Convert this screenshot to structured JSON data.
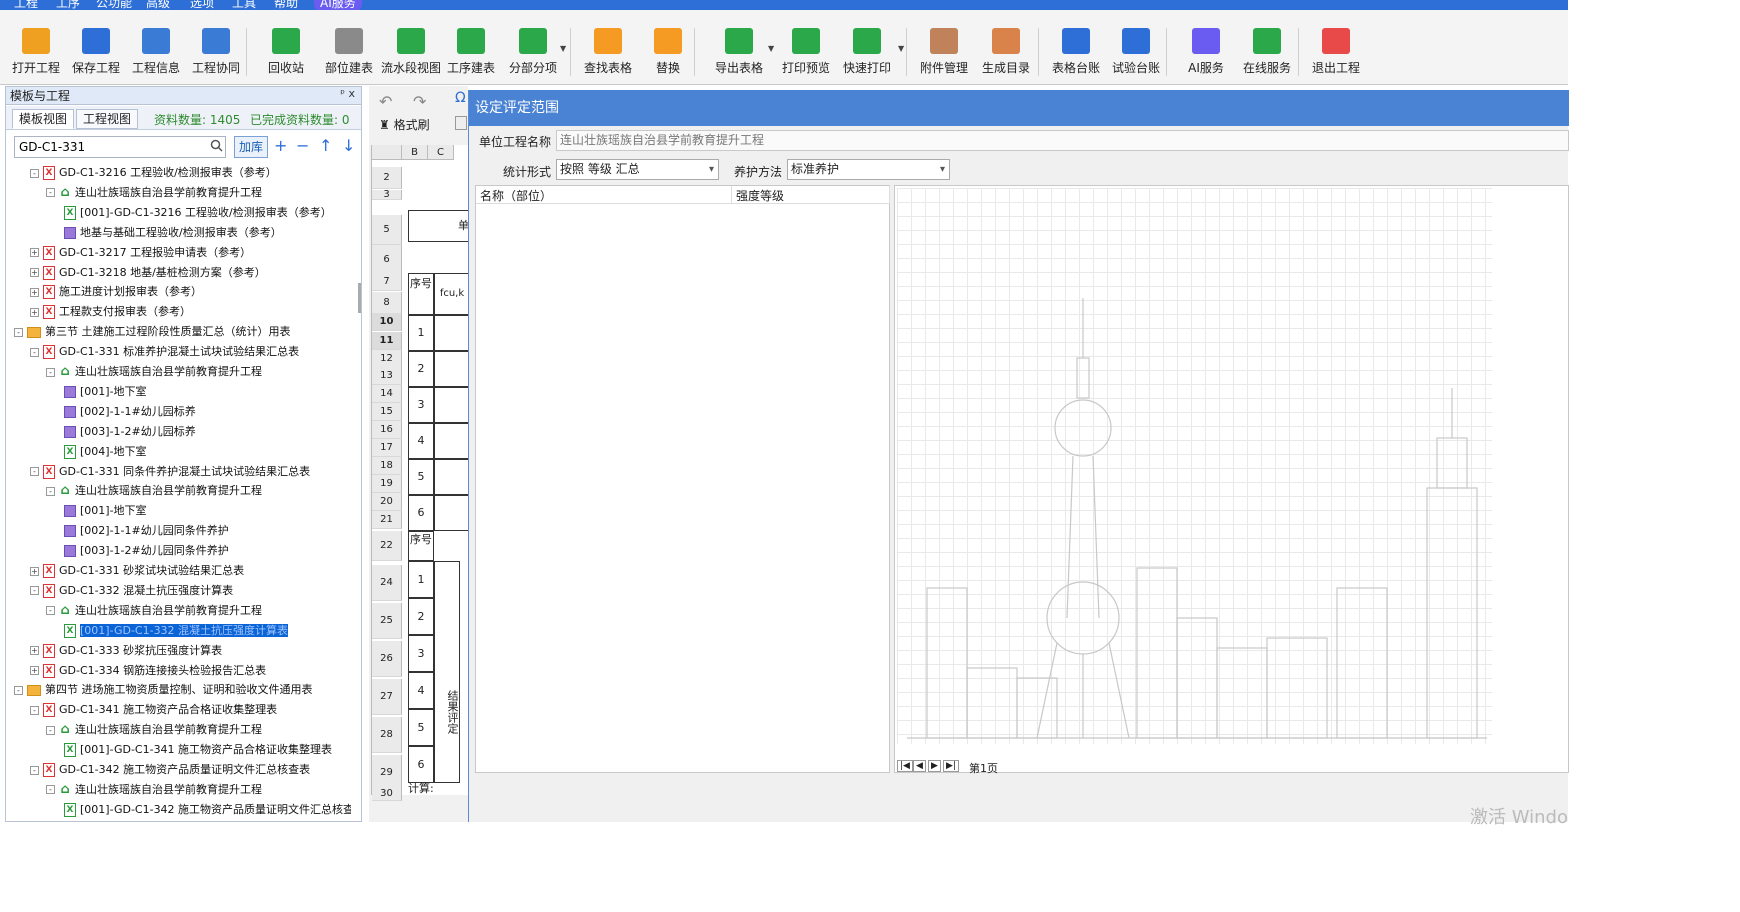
{
  "menu": [
    "工程",
    "工序",
    "公功能",
    "高级",
    "选项",
    "工具",
    "帮助",
    "AI服务"
  ],
  "toolbar": [
    {
      "label": "打开工程",
      "icon": "open-folder-icon",
      "color": "#f0a020"
    },
    {
      "label": "保存工程",
      "icon": "save-icon",
      "color": "#2d6fd6"
    },
    {
      "label": "工程信息",
      "icon": "building-icon",
      "color": "#3a7bd5"
    },
    {
      "label": "工程协同",
      "icon": "handshake-icon",
      "color": "#3a7bd5"
    },
    {
      "label": "回收站",
      "icon": "trash-icon",
      "color": "#2aa84a"
    },
    {
      "label": "部位建表",
      "icon": "part-table-icon",
      "color": "#8a8a8a"
    },
    {
      "label": "流水段视图",
      "icon": "flow-view-icon",
      "color": "#2aa84a"
    },
    {
      "label": "工序建表",
      "icon": "process-table-icon",
      "color": "#2aa84a"
    },
    {
      "label": "分部分项",
      "icon": "chart-icon",
      "color": "#2aa84a"
    },
    {
      "label": "查找表格",
      "icon": "search-icon",
      "color": "#f59a23"
    },
    {
      "label": "替换",
      "icon": "replace-icon",
      "color": "#f59a23"
    },
    {
      "label": "导出表格",
      "icon": "export-icon",
      "color": "#2aa84a"
    },
    {
      "label": "打印预览",
      "icon": "eye-icon",
      "color": "#2aa84a"
    },
    {
      "label": "快速打印",
      "icon": "printer-icon",
      "color": "#2aa84a"
    },
    {
      "label": "附件管理",
      "icon": "attachment-icon",
      "color": "#c0825a"
    },
    {
      "label": "生成目录",
      "icon": "catalog-icon",
      "color": "#d9834a"
    },
    {
      "label": "表格台账",
      "icon": "table-ledger-icon",
      "color": "#2d6fd6"
    },
    {
      "label": "试验台账",
      "icon": "test-ledger-icon",
      "color": "#2d6fd6"
    },
    {
      "label": "AI服务",
      "icon": "ai-icon",
      "color": "#6a5cf0"
    },
    {
      "label": "在线服务",
      "icon": "headset-icon",
      "color": "#2aa84a"
    },
    {
      "label": "退出工程",
      "icon": "power-icon",
      "color": "#e84a4a"
    }
  ],
  "left_panel": {
    "title": "模板与工程",
    "pin": "ᵖ x",
    "tabs": [
      "模板视图",
      "工程视图"
    ],
    "material_count": "资料数量: 1405",
    "done_count": "已完成资料数量: 0",
    "search_value": "GD-C1-331",
    "add_lib": "加库"
  },
  "tree": [
    {
      "text": "GD-C1-3216 工程验收/检测报审表（参考）",
      "icon": "x",
      "indent": 0,
      "exp": "-"
    },
    {
      "text": "连山壮族瑶族自治县学前教育提升工程",
      "icon": "home",
      "indent": 1,
      "exp": "-"
    },
    {
      "text": "[001]-GD-C1-3216 工程验收/检测报审表（参考）",
      "icon": "xg",
      "indent": 2,
      "exp": ""
    },
    {
      "text": "地基与基础工程验收/检测报审表（参考）",
      "icon": "grid",
      "indent": 2,
      "exp": ""
    },
    {
      "text": "GD-C1-3217 工程报验申请表（参考）",
      "icon": "x",
      "indent": 0,
      "exp": "+"
    },
    {
      "text": "GD-C1-3218 地基/基桩检测方案（参考）",
      "icon": "x",
      "indent": 0,
      "exp": "+"
    },
    {
      "text": "施工进度计划报审表（参考）",
      "icon": "x",
      "indent": 0,
      "exp": "+"
    },
    {
      "text": "工程款支付报审表（参考）",
      "icon": "x",
      "indent": 0,
      "exp": "+"
    },
    {
      "text": "第三节 土建施工过程阶段性质量汇总（统计）用表",
      "icon": "folder",
      "indent": -1,
      "exp": "-"
    },
    {
      "text": "GD-C1-331 标准养护混凝土试块试验结果汇总表",
      "icon": "x",
      "indent": 0,
      "exp": "-"
    },
    {
      "text": "连山壮族瑶族自治县学前教育提升工程",
      "icon": "home",
      "indent": 1,
      "exp": "-"
    },
    {
      "text": "[001]-地下室",
      "icon": "grid",
      "indent": 2,
      "exp": ""
    },
    {
      "text": "[002]-1-1#幼儿园标养",
      "icon": "grid",
      "indent": 2,
      "exp": ""
    },
    {
      "text": "[003]-1-2#幼儿园标养",
      "icon": "grid",
      "indent": 2,
      "exp": ""
    },
    {
      "text": "[004]-地下室",
      "icon": "xg",
      "indent": 2,
      "exp": ""
    },
    {
      "text": "GD-C1-331 同条件养护混凝土试块试验结果汇总表",
      "icon": "x",
      "indent": 0,
      "exp": "-"
    },
    {
      "text": "连山壮族瑶族自治县学前教育提升工程",
      "icon": "home",
      "indent": 1,
      "exp": "-"
    },
    {
      "text": "[001]-地下室",
      "icon": "grid",
      "indent": 2,
      "exp": ""
    },
    {
      "text": "[002]-1-1#幼儿园同条件养护",
      "icon": "grid",
      "indent": 2,
      "exp": ""
    },
    {
      "text": "[003]-1-2#幼儿园同条件养护",
      "icon": "grid",
      "indent": 2,
      "exp": ""
    },
    {
      "text": "GD-C1-331 砂浆试块试验结果汇总表",
      "icon": "x",
      "indent": 0,
      "exp": "+"
    },
    {
      "text": "GD-C1-332 混凝土抗压强度计算表",
      "icon": "x",
      "indent": 0,
      "exp": "-"
    },
    {
      "text": "连山壮族瑶族自治县学前教育提升工程",
      "icon": "home",
      "indent": 1,
      "exp": "-"
    },
    {
      "text": "[001]-GD-C1-332 混凝土抗压强度计算表",
      "icon": "xg",
      "indent": 2,
      "exp": "",
      "selected": true
    },
    {
      "text": "GD-C1-333 砂浆抗压强度计算表",
      "icon": "x",
      "indent": 0,
      "exp": "+"
    },
    {
      "text": "GD-C1-334 钢筋连接接头检验报告汇总表",
      "icon": "x",
      "indent": 0,
      "exp": "+"
    },
    {
      "text": "第四节 进场施工物资质量控制、证明和验收文件通用表",
      "icon": "folder",
      "indent": -1,
      "exp": "-"
    },
    {
      "text": "GD-C1-341 施工物资产品合格证收集整理表",
      "icon": "x",
      "indent": 0,
      "exp": "-"
    },
    {
      "text": "连山壮族瑶族自治县学前教育提升工程",
      "icon": "home",
      "indent": 1,
      "exp": "-"
    },
    {
      "text": "[001]-GD-C1-341 施工物资产品合格证收集整理表",
      "icon": "xg",
      "indent": 2,
      "exp": ""
    },
    {
      "text": "GD-C1-342 施工物资产品质量证明文件汇总核查表",
      "icon": "x",
      "indent": 0,
      "exp": "-"
    },
    {
      "text": "连山壮族瑶族自治县学前教育提升工程",
      "icon": "home",
      "indent": 1,
      "exp": "-"
    },
    {
      "text": "[001]-GD-C1-342 施工物资产品质量证明文件汇总核查",
      "icon": "xg",
      "indent": 2,
      "exp": ""
    }
  ],
  "editor": {
    "format_brush": "格式刷",
    "col_b": "B",
    "col_c": "C",
    "rows": [
      "2",
      "3",
      "5",
      "6",
      "7",
      "8",
      "10",
      "11",
      "12",
      "13",
      "14",
      "15",
      "16",
      "17",
      "18",
      "19",
      "20",
      "21",
      "22",
      "24",
      "25",
      "26",
      "27",
      "28",
      "29",
      "30"
    ],
    "seq_label": "序号",
    "fcu": "fcu,k",
    "nums": [
      "1",
      "2",
      "3",
      "4",
      "5",
      "6"
    ],
    "seq_label2": "序号",
    "nums2": [
      "1",
      "2",
      "3",
      "4",
      "5",
      "6"
    ],
    "result_label": "结果评定",
    "calc_label": "计算:",
    "unit_fragment": "单"
  },
  "dialog": {
    "title": "设定评定范围",
    "project_label": "单位工程名称",
    "project_value": "连山壮族瑶族自治县学前教育提升工程",
    "stat_label": "统计形式",
    "stat_value": "按照 等级 汇总",
    "cure_label": "养护方法",
    "cure_value": "标准养护",
    "col_name": "名称（部位）",
    "col_grade": "强度等级",
    "sheet_tab": "第1页"
  },
  "watermark": "激活 Windo"
}
